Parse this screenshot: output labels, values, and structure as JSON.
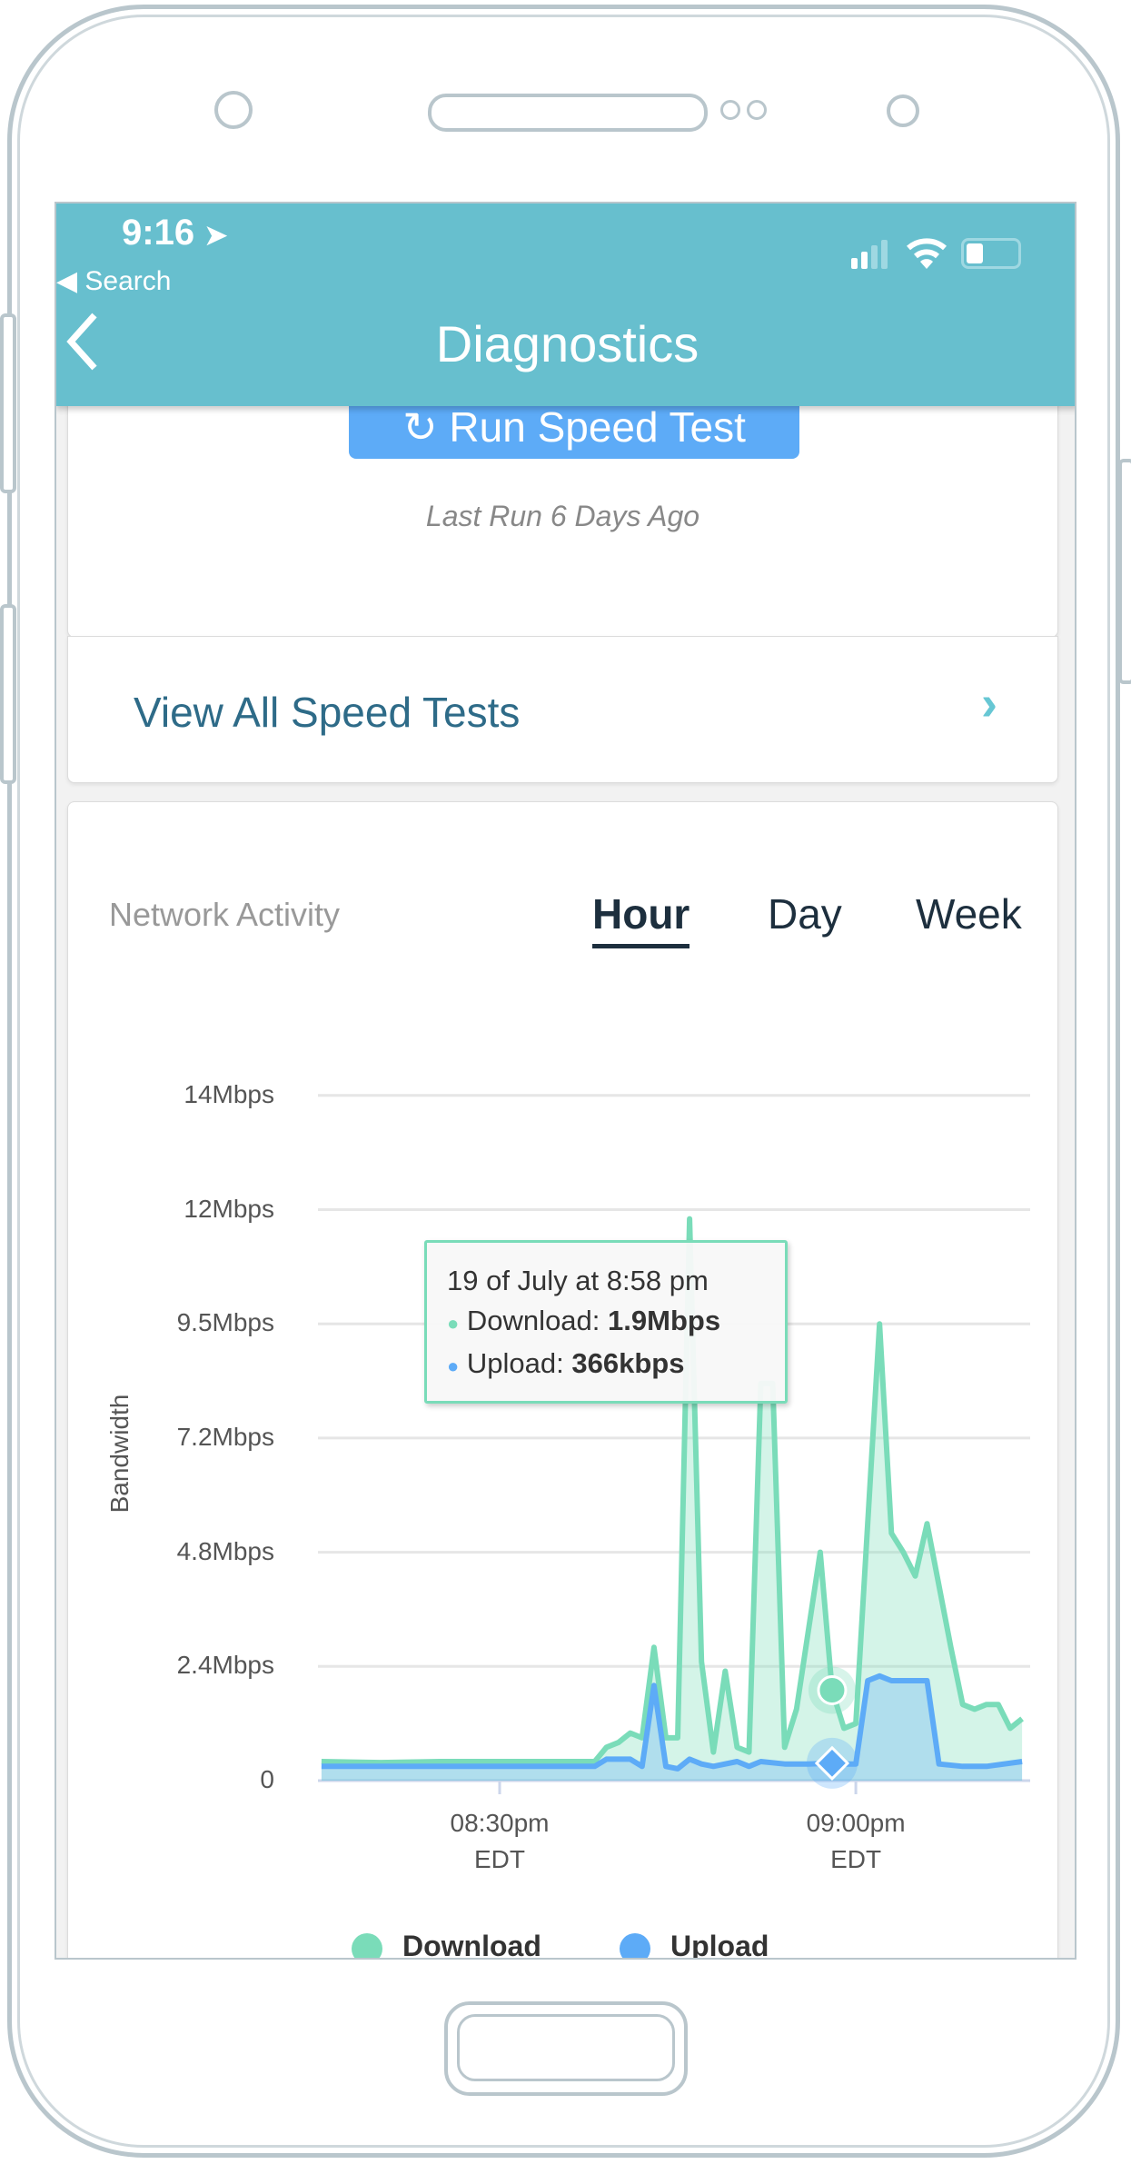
{
  "status_bar": {
    "time": "9:16",
    "back_app": "Search"
  },
  "header": {
    "title": "Diagnostics"
  },
  "speed_test": {
    "button_label": "Run Speed Test",
    "last_run": "Last Run 6 Days Ago"
  },
  "view_all": {
    "label": "View All Speed Tests"
  },
  "network_activity": {
    "title": "Network Activity",
    "tabs": [
      {
        "label": "Hour",
        "selected": true
      },
      {
        "label": "Day",
        "selected": false
      },
      {
        "label": "Week",
        "selected": false
      }
    ]
  },
  "tooltip": {
    "title": "19 of July at 8:58 pm",
    "download_label": "Download:",
    "download_value": "1.9Mbps",
    "upload_label": "Upload:",
    "upload_value": "366kbps"
  },
  "colors": {
    "header": "#67bfce",
    "button": "#5dabf7",
    "download": "#7adcb9",
    "upload": "#5dabf7",
    "link": "#2e6b88"
  },
  "chart_data": {
    "type": "area",
    "ylabel": "Bandwidth",
    "yticks": [
      "0",
      "2.4Mbps",
      "4.8Mbps",
      "7.2Mbps",
      "9.5Mbps",
      "12Mbps",
      "14Mbps"
    ],
    "ytick_values": [
      0,
      2.4,
      4.8,
      7.2,
      9.5,
      12,
      14
    ],
    "xticks": [
      {
        "time": "20:30",
        "label": "08:30pm",
        "tz": "EDT"
      },
      {
        "time": "21:00",
        "label": "09:00pm",
        "tz": "EDT"
      }
    ],
    "xlim": [
      "20:15",
      "21:15"
    ],
    "grid": true,
    "legend": "bottom",
    "highlight_time": "20:58",
    "series": [
      {
        "name": "Download",
        "color": "#7adcb9",
        "points": [
          [
            "20:15",
            0.4
          ],
          [
            "20:20",
            0.38
          ],
          [
            "20:25",
            0.4
          ],
          [
            "20:30",
            0.4
          ],
          [
            "20:35",
            0.4
          ],
          [
            "20:38",
            0.4
          ],
          [
            "20:39",
            0.7
          ],
          [
            "20:40",
            0.8
          ],
          [
            "20:41",
            1.0
          ],
          [
            "20:42",
            0.9
          ],
          [
            "20:43",
            2.8
          ],
          [
            "20:44",
            0.9
          ],
          [
            "20:45",
            0.9
          ],
          [
            "20:46",
            11.8
          ],
          [
            "20:47",
            2.5
          ],
          [
            "20:48",
            0.6
          ],
          [
            "20:49",
            2.3
          ],
          [
            "20:50",
            0.7
          ],
          [
            "20:51",
            0.6
          ],
          [
            "20:52",
            8.3
          ],
          [
            "20:53",
            8.3
          ],
          [
            "20:54",
            0.7
          ],
          [
            "20:55",
            1.5
          ],
          [
            "20:57",
            4.8
          ],
          [
            "20:58",
            1.9
          ],
          [
            "20:59",
            1.1
          ],
          [
            "21:00",
            1.2
          ],
          [
            "21:02",
            9.5
          ],
          [
            "21:03",
            5.2
          ],
          [
            "21:04",
            4.8
          ],
          [
            "21:05",
            4.3
          ],
          [
            "21:06",
            5.4
          ],
          [
            "21:08",
            2.8
          ],
          [
            "21:09",
            1.6
          ],
          [
            "21:10",
            1.5
          ],
          [
            "21:11",
            1.6
          ],
          [
            "21:12",
            1.6
          ],
          [
            "21:13",
            1.1
          ],
          [
            "21:14",
            1.3
          ]
        ]
      },
      {
        "name": "Upload",
        "color": "#5dabf7",
        "points": [
          [
            "20:15",
            0.3
          ],
          [
            "20:25",
            0.3
          ],
          [
            "20:30",
            0.3
          ],
          [
            "20:38",
            0.3
          ],
          [
            "20:39",
            0.45
          ],
          [
            "20:41",
            0.45
          ],
          [
            "20:42",
            0.3
          ],
          [
            "20:43",
            2.0
          ],
          [
            "20:44",
            0.3
          ],
          [
            "20:45",
            0.25
          ],
          [
            "20:46",
            0.45
          ],
          [
            "20:47",
            0.35
          ],
          [
            "20:48",
            0.3
          ],
          [
            "20:50",
            0.4
          ],
          [
            "20:51",
            0.3
          ],
          [
            "20:52",
            0.4
          ],
          [
            "20:54",
            0.35
          ],
          [
            "20:56",
            0.35
          ],
          [
            "20:58",
            0.366
          ],
          [
            "20:59",
            0.35
          ],
          [
            "21:00",
            0.35
          ],
          [
            "21:01",
            2.1
          ],
          [
            "21:02",
            2.2
          ],
          [
            "21:03",
            2.1
          ],
          [
            "21:06",
            2.1
          ],
          [
            "21:07",
            0.35
          ],
          [
            "21:09",
            0.3
          ],
          [
            "21:11",
            0.3
          ],
          [
            "21:14",
            0.4
          ]
        ]
      }
    ]
  }
}
